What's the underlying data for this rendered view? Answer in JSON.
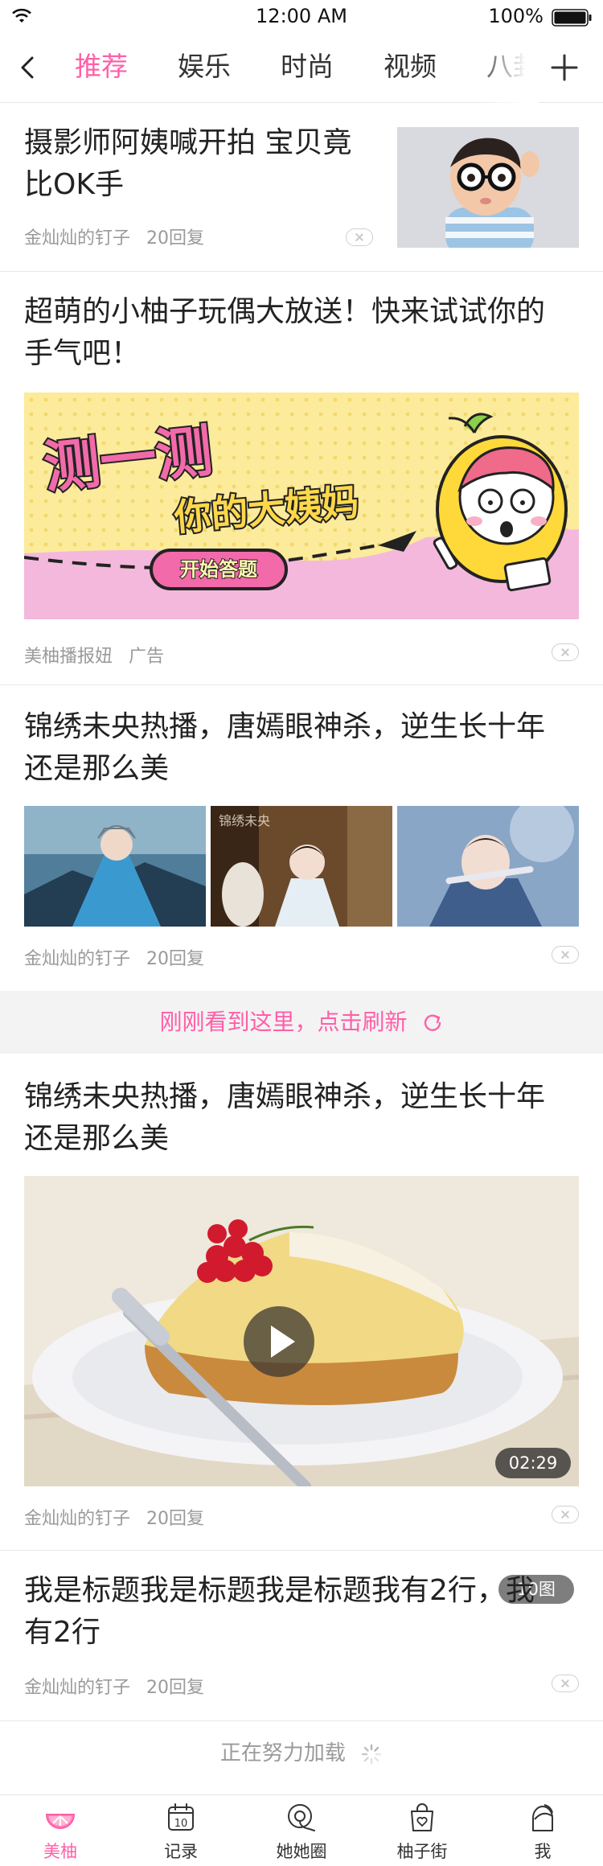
{
  "status_bar": {
    "time": "12:00 AM",
    "battery": "100%"
  },
  "nav": {
    "tabs": [
      {
        "label": "推荐",
        "active": true
      },
      {
        "label": "娱乐",
        "active": false
      },
      {
        "label": "时尚",
        "active": false
      },
      {
        "label": "视频",
        "active": false
      },
      {
        "label": "八卦",
        "active": false
      }
    ]
  },
  "feed": [
    {
      "title_line1": "摄影师阿姨喊开拍 宝贝竟",
      "title_line2": "比OK手",
      "author": "金灿灿的钉子",
      "replies": "20回复"
    },
    {
      "title_line1": "超萌的小柚子玩偶大放送！快来试试你的",
      "title_line2": "手气吧！",
      "author": "美柚播报妞",
      "tag": "广告",
      "banner": {
        "line1": "测一测",
        "line2": "你的大姨妈",
        "button": "开始答题"
      }
    },
    {
      "title_line1": "锦绣未央热播，唐嫣眼神杀，逆生长十年",
      "title_line2": "还是那么美",
      "author": "金灿灿的钉子",
      "replies": "20回复",
      "image_count": "10图",
      "thumb_caption": "锦绣未央"
    },
    {
      "title_line1": "锦绣未央热播，唐嫣眼神杀，逆生长十年",
      "title_line2": "还是那么美",
      "author": "金灿灿的钉子",
      "replies": "20回复",
      "duration": "02:29"
    },
    {
      "title_line1": "我是标题我是标题我是标题我有2行，我",
      "title_line2": "有2行",
      "author": "金灿灿的钉子",
      "replies": "20回复"
    }
  ],
  "refresh_text": "刚刚看到这里，点击刷新",
  "loading_text": "正在努力加载",
  "tab_bar": [
    {
      "label": "美柚",
      "icon": "grapefruit-icon",
      "active": true
    },
    {
      "label": "记录",
      "icon": "calendar-icon",
      "active": false
    },
    {
      "label": "她她圈",
      "icon": "search-circle-icon",
      "active": false
    },
    {
      "label": "柚子街",
      "icon": "shopping-bag-icon",
      "active": false
    },
    {
      "label": "我",
      "icon": "profile-icon",
      "active": false
    }
  ],
  "colors": {
    "accent": "#ff5fa8",
    "text": "#222222",
    "meta": "#9a9a9a",
    "divider": "#e8e8e8"
  }
}
